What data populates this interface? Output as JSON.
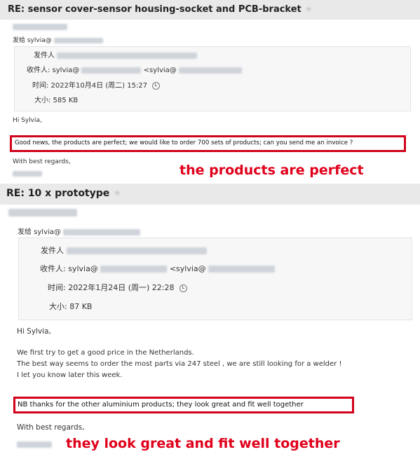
{
  "email1": {
    "subject": "RE: sensor cover-sensor housing-socket and PCB-bracket",
    "to_label": "发给 sylvia@",
    "from_label": "发件人",
    "recipient_label": "收件人: sylvia@",
    "recipient_suffix": "<sylvia@",
    "time_label": "时间: 2022年10月4日 (周二) 15:27",
    "size_label": "大小: 585 KB",
    "greeting": "Hi Sylvia,",
    "highlight_text": "Good news, the products are perfect; we would like to order 700 sets of products; can you send me an invoice ?",
    "signoff": "With best regards,",
    "overlay_caption": "the products are perfect"
  },
  "email2": {
    "subject": "RE: 10 x prototype",
    "to_label": "发给 sylvia@",
    "from_label": "发件人",
    "recipient_label": "收件人: sylvia@",
    "recipient_suffix": "<sylvia@",
    "time_label": "时间: 2022年1月24日 (周一) 22:28",
    "size_label": "大小: 87 KB",
    "greeting": "Hi Sylvia,",
    "body_line1": "We first try to get a good price in the Netherlands.",
    "body_line2": "The best way seems to order the most parts via 247 steel , we are still looking for a welder !",
    "body_line3": "I let you know later this week.",
    "highlight_text": "NB thanks for the other aluminium products; they look great and fit well together",
    "signoff": "With best regards,",
    "overlay_caption": "they look great and fit well together"
  },
  "colors": {
    "highlight": "#d0021b",
    "caption": "#e0001b",
    "subject_bg": "#e9e9e9"
  }
}
